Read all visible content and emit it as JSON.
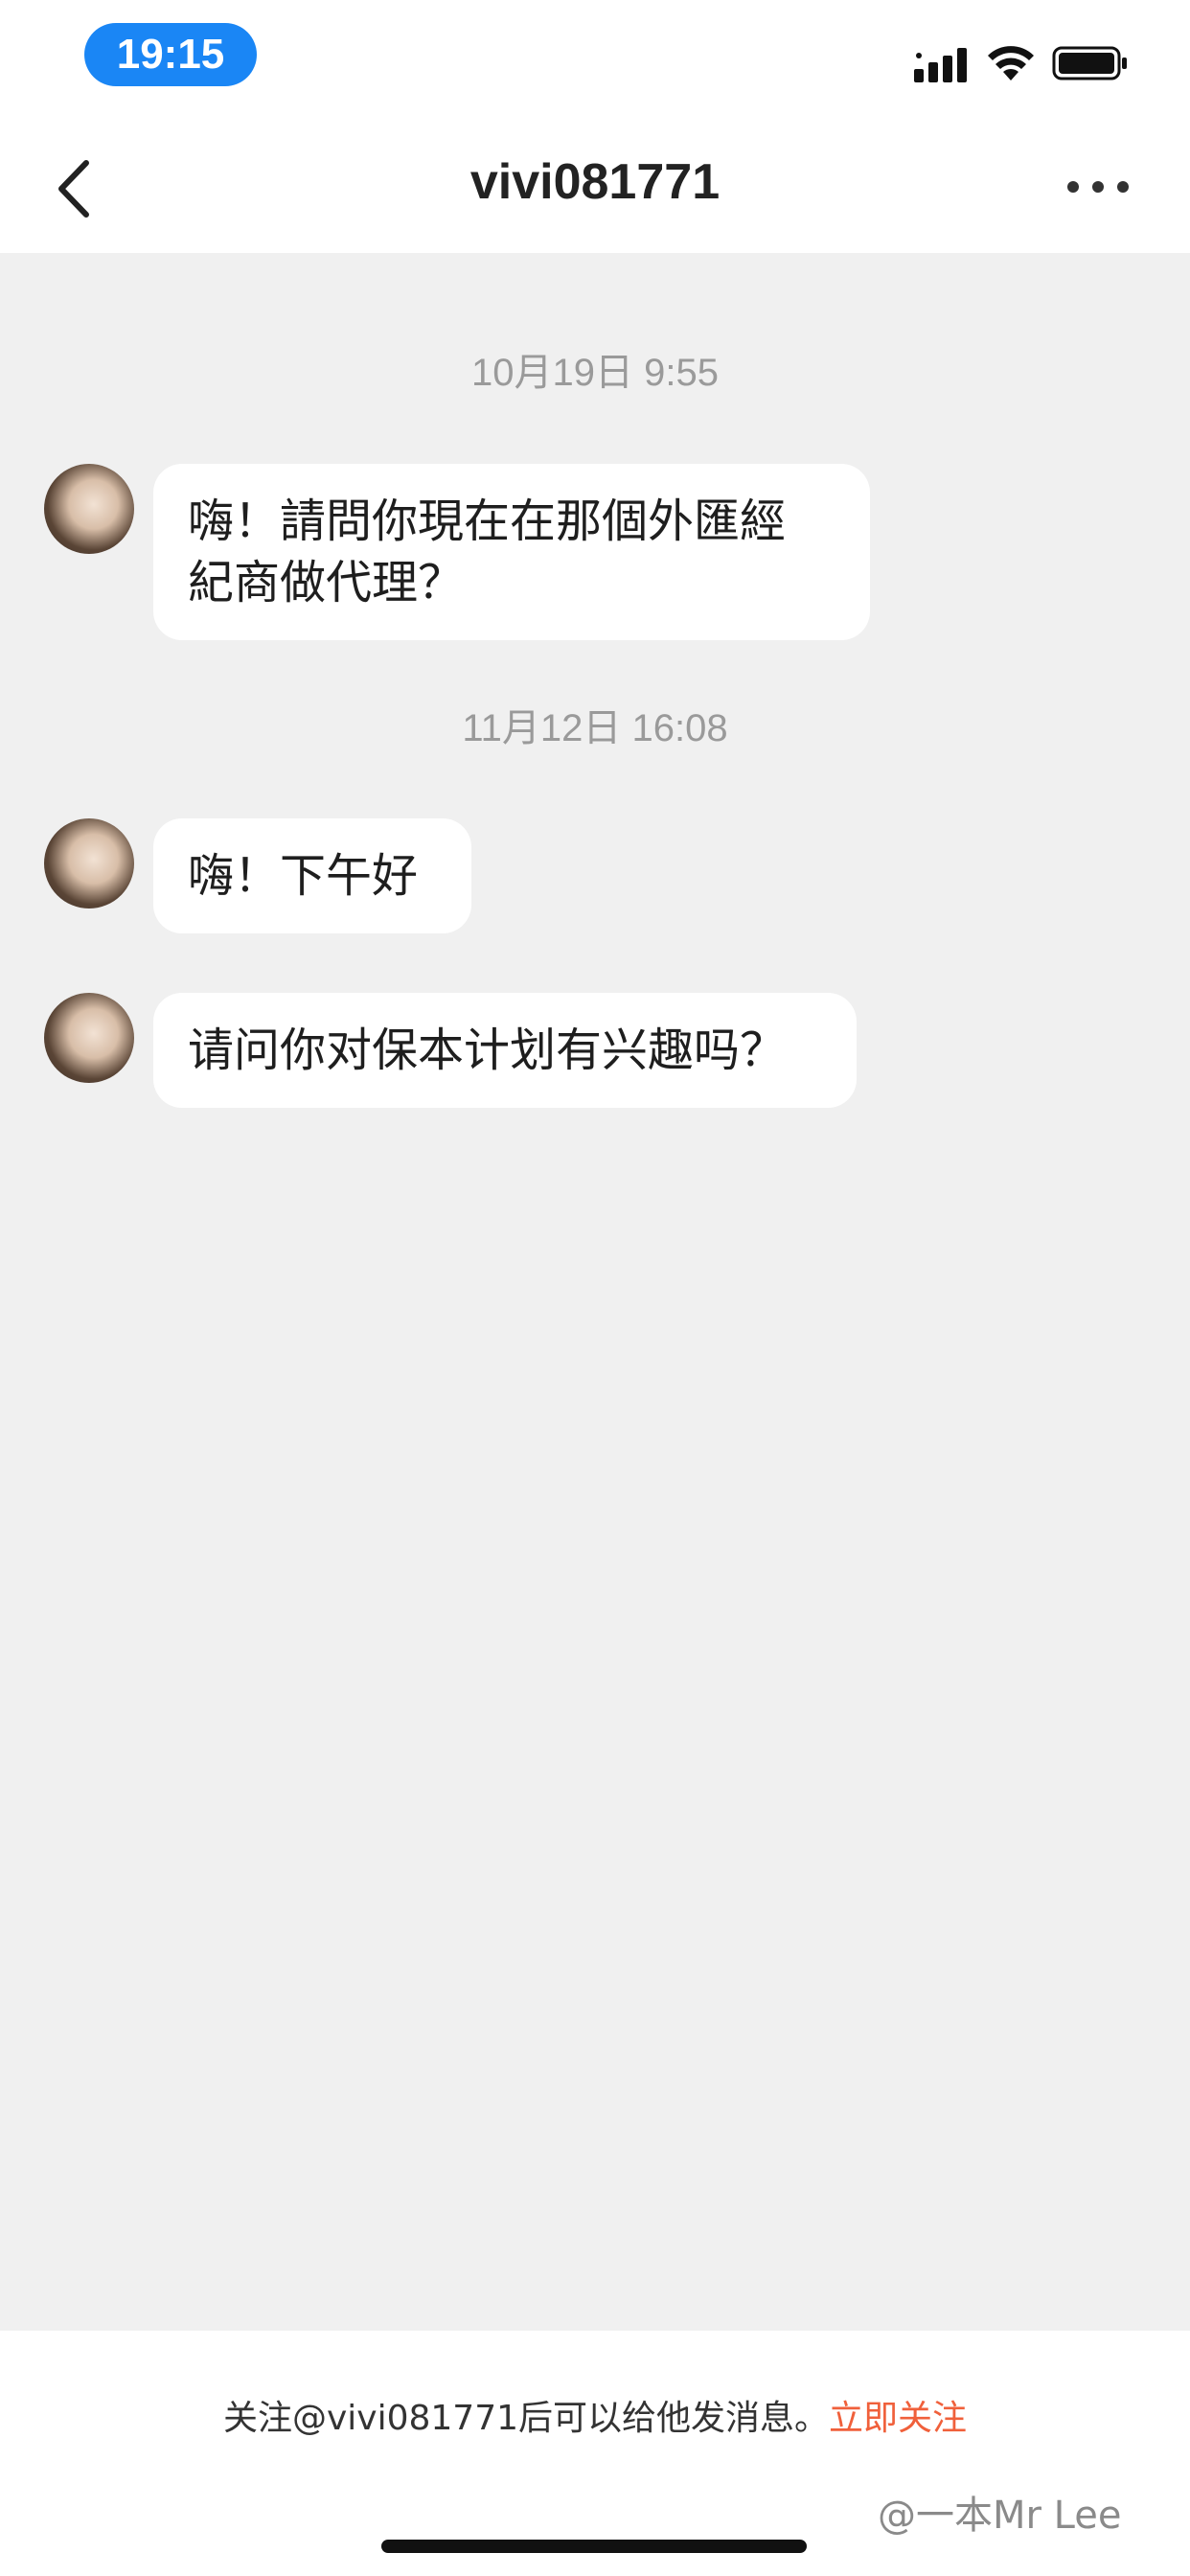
{
  "status_bar": {
    "time": "19:15",
    "signal_icon": "cellular-signal-icon",
    "wifi_icon": "wifi-icon",
    "battery_icon": "battery-icon"
  },
  "nav": {
    "title": "vivi081771",
    "back_icon": "chevron-left-icon",
    "more_icon": "more-dots-icon"
  },
  "messages": [
    {
      "type": "timestamp",
      "text": "10月19日 9:55"
    },
    {
      "type": "incoming",
      "lines": [
        "嗨！請問你現在在那個外匯經",
        "紀商做代理？"
      ]
    },
    {
      "type": "timestamp",
      "text": "11月12日 16:08"
    },
    {
      "type": "incoming",
      "lines": [
        "嗨！下午好"
      ]
    },
    {
      "type": "incoming",
      "lines": [
        "请问你对保本计划有兴趣吗？"
      ]
    }
  ],
  "footer": {
    "notice_text": "关注@vivi081771后可以给他发消息。",
    "follow_link": "立即关注",
    "watermark": "@一本Mr Lee"
  },
  "colors": {
    "accent_blue": "#1a86f5",
    "follow_orange": "#f0603b",
    "chat_background": "#f0f0f0",
    "bubble": "#ffffff"
  }
}
